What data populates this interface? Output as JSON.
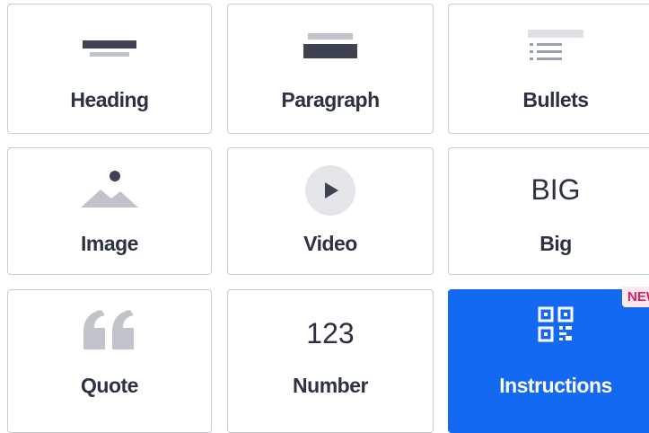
{
  "blocks": {
    "heading": {
      "label": "Heading",
      "icon": "heading-icon"
    },
    "paragraph": {
      "label": "Paragraph",
      "icon": "paragraph-icon"
    },
    "bullets": {
      "label": "Bullets",
      "icon": "bullets-icon"
    },
    "image": {
      "label": "Image",
      "icon": "image-icon"
    },
    "video": {
      "label": "Video",
      "icon": "play-icon"
    },
    "big": {
      "label": "Big",
      "icon_text": "BIG"
    },
    "quote": {
      "label": "Quote",
      "icon": "quote-icon"
    },
    "number": {
      "label": "Number",
      "icon_text": "123"
    },
    "instructions": {
      "label": "Instructions",
      "icon": "qr-code-icon",
      "badge": "NEW",
      "selected": true
    }
  },
  "colors": {
    "accent": "#1469f2",
    "icon_dark": "#3d4353",
    "icon_light": "#c0c3c9",
    "badge_text": "#d6215f",
    "badge_bg": "#ffe6ef"
  }
}
